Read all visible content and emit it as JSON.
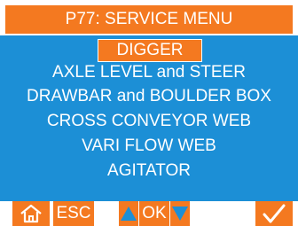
{
  "header": {
    "title": "P77: SERVICE MENU"
  },
  "menu": {
    "items": [
      {
        "label": "DIGGER",
        "selected": true
      },
      {
        "label": "AXLE LEVEL and STEER",
        "selected": false
      },
      {
        "label": "DRAWBAR and BOULDER BOX",
        "selected": false
      },
      {
        "label": "CROSS CONVEYOR WEB",
        "selected": false
      },
      {
        "label": "VARI FLOW WEB",
        "selected": false
      },
      {
        "label": "AGITATOR",
        "selected": false
      }
    ]
  },
  "footer": {
    "home_icon": "home-icon",
    "esc_label": "ESC",
    "up_icon": "up-arrow-icon",
    "ok_label": "OK",
    "down_icon": "down-arrow-icon",
    "confirm_icon": "checkmark-icon"
  },
  "colors": {
    "accent": "#f47920",
    "menu_background": "#1c8fd6",
    "up_arrow": "#1c8fd6",
    "text": "#ffffff"
  }
}
